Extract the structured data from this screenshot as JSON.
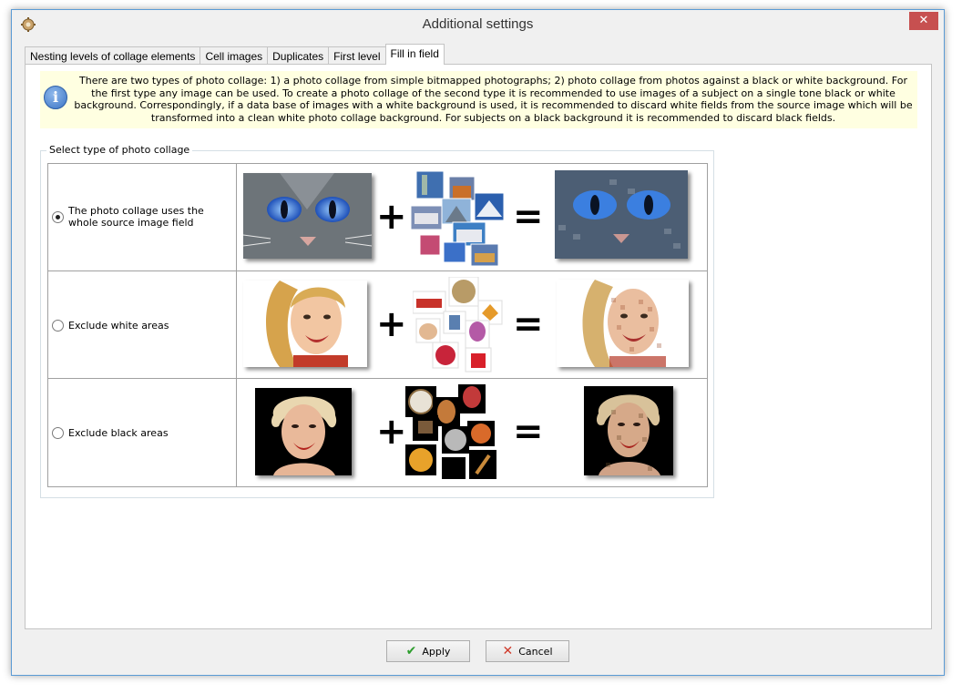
{
  "window": {
    "title": "Additional settings",
    "close_label": "✕"
  },
  "tabs": [
    {
      "label": "Nesting levels of collage elements"
    },
    {
      "label": "Cell images"
    },
    {
      "label": "Duplicates"
    },
    {
      "label": "First level"
    },
    {
      "label": "Fill in field",
      "active": true
    }
  ],
  "info": {
    "icon": "info-icon",
    "text": "There are two types of photo collage: 1) a photo collage from simple bitmapped photographs; 2) photo collage from photos against a black or white background. For the first type any image can be used. To create a photo collage of the second type it is recommended to use images of a subject on a single tone black or white background. Correspondingly, if a data base of images with a white background is used, it is recommended to discard white fields from the source image which will be transformed into a clean white photo collage background. For subjects on a black background it is recommended to discard black fields."
  },
  "collage_type": {
    "legend": "Select type of photo collage",
    "options": [
      {
        "label": "The photo collage uses the whole source image field",
        "checked": true
      },
      {
        "label": "Exclude white areas",
        "checked": false
      },
      {
        "label": "Exclude black areas",
        "checked": false
      }
    ],
    "plus_symbol": "+",
    "equals_symbol": "="
  },
  "buttons": {
    "apply_label": "Apply",
    "cancel_label": "Cancel"
  },
  "colors": {
    "info_background": "#ffffe1",
    "close_button": "#c75050",
    "apply_check": "#2e9e2e",
    "cancel_x": "#d03a2a"
  }
}
